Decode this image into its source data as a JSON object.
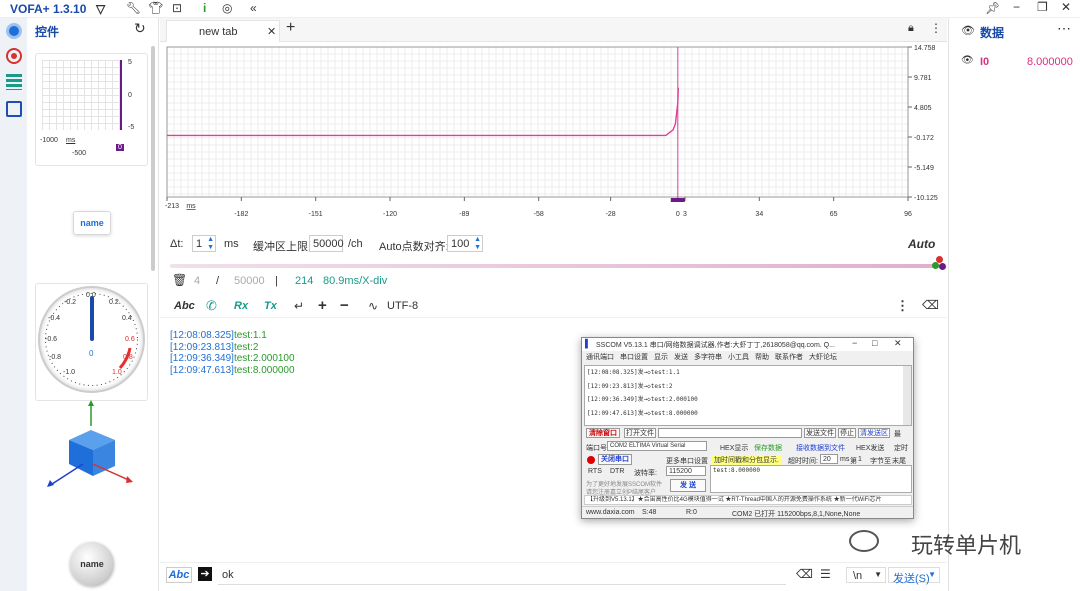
{
  "app": {
    "title": "VOFA+ 1.3.10"
  },
  "left_panel": {
    "title": "控件",
    "mini_chart": {
      "y_ticks": [
        "5",
        "0",
        "-5"
      ],
      "x_ticks": [
        "-1000",
        "ms",
        "-500",
        "0"
      ]
    },
    "name_button_1": "name",
    "gauge": {
      "ticks": [
        "-0.2",
        "0.0",
        "0.2",
        "-0.4",
        "0.4",
        "-0.6",
        "0.6",
        "-0.8",
        "0.8",
        "-1.0",
        "1.0"
      ],
      "value": "0"
    },
    "name_button_2": "name"
  },
  "tabs": [
    {
      "label": "new tab"
    }
  ],
  "chart_data": {
    "type": "line",
    "series": [
      {
        "name": "I0",
        "x": [
          -213,
          -5,
          -2,
          -1,
          0,
          0.2
        ],
        "values": [
          0.1,
          0.1,
          1.0,
          2.0,
          5.5,
          8.0
        ]
      }
    ],
    "y_ticks": [
      "14.758",
      "9.781",
      "4.805",
      "-0.172",
      "-5.149",
      "-10.125"
    ],
    "x_ticks": [
      "-213",
      "ms",
      "-182",
      "-151",
      "-120",
      "-89",
      "-58",
      "-28",
      "0",
      "3",
      "34",
      "65",
      "96"
    ],
    "xlim": [
      -213,
      96
    ],
    "ylim": [
      -10.125,
      14.758
    ],
    "grid": true
  },
  "chart_colors": {
    "series": "#e0409a",
    "accent": "#6b1a8a"
  },
  "controls": {
    "dt_label": "Δt:",
    "dt_value": "1",
    "dt_unit": "ms",
    "buffer_label": "缓冲区上限:",
    "buffer_value": "50000",
    "buffer_unit": "/ch",
    "auto_label": "Auto点数对齐:",
    "auto_value": "100",
    "auto_text": "Auto"
  },
  "stats": {
    "a": "4",
    "slash": "/",
    "b": "50000",
    "sep": "|",
    "c": "214",
    "d": "80.9ms/X-div"
  },
  "console_toolbar": {
    "abc": "Abc",
    "rx": "Rx",
    "tx": "Tx",
    "plus": "+",
    "minus": "−",
    "encoding": "UTF-8"
  },
  "log_lines": [
    {
      "ts": "[12:08:08.325]",
      "msg": "test:1.1"
    },
    {
      "ts": "[12:09:23.813]",
      "msg": "test:2"
    },
    {
      "ts": "[12:09:36.349]",
      "msg": "test:2.000100"
    },
    {
      "ts": "[12:09:47.613]",
      "msg": "test:8.000000"
    }
  ],
  "sscom": {
    "title": "SSCOM V5.13.1 串口/网络数据调试器,作者:大虾丁丁,2618058@qq.com. Q...",
    "menu": [
      "通讯端口",
      "串口设置",
      "显示",
      "发送",
      "多字符串",
      "小工具",
      "帮助",
      "联系作者",
      "大虾论坛"
    ],
    "lines": [
      "[12:08:08.325]发→◇test:1.1",
      "[12:09:23.813]发→◇test:2",
      "[12:09:36.349]发→◇test:2.000100",
      "[12:09:47.613]发→◇test:8.000000"
    ],
    "clear_window": "清除窗口",
    "open_file": "打开文件",
    "send_file": "发送文件",
    "stop": "停止",
    "clear_send": "清发送区",
    "topmost": "最",
    "port_label": "端口号",
    "port_value": "COM2 ELTIMA Virtual Serial",
    "hex_display": "HEX显示",
    "save_data": "保存数据",
    "recv_to_file": "接收数据到文件",
    "hex_send": "HEX发送",
    "timed": "定时",
    "close_port": "关闭串口",
    "more_settings": "更多串口设置",
    "timestamp_label": "加时间戳和分包显示.",
    "timeout_label": "超时时间:",
    "timeout_value": "20",
    "ms_label": "ms",
    "no_label": "第",
    "byte_value": "1",
    "byte_label": "字节",
    "to_label": "至",
    "end_label": "末尾",
    "rts": "RTS",
    "dtr": "DTR",
    "baud_label": "波特率:",
    "baud_value": "115200",
    "send_text": "test:8.000000",
    "hint1": "为了更好地发展SSCOM软件",
    "hint2": "请您注册嘉立创P结尾客户",
    "send_button": "发 送",
    "ticker": "【升级到V5.13.1】★合宙高性价比4G模块值得一试 ★RT-Thread中国人的开源免费操作系统 ★新一代WiFi芯片",
    "status": [
      "www.daxia.com",
      "S:48",
      "R:0",
      "COM2 已打开  115200bps,8,1,None,None"
    ]
  },
  "right_panel": {
    "title": "数据",
    "items": [
      {
        "name": "I0",
        "value": "8.000000"
      }
    ]
  },
  "send_bar": {
    "abc": "Abc",
    "input_value": "ok",
    "newline": "\\n",
    "send_button": "发送(S)"
  },
  "watermark": "玩转单片机"
}
